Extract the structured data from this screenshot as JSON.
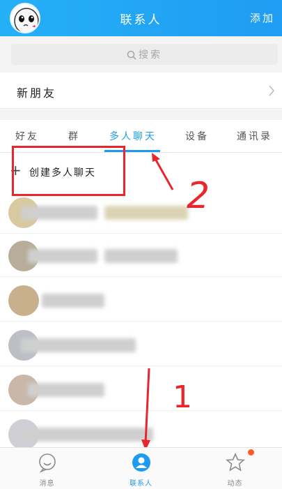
{
  "header": {
    "title": "联系人",
    "add_label": "添加"
  },
  "search": {
    "placeholder": "搜索"
  },
  "new_friends": {
    "label": "新朋友"
  },
  "tabs": [
    {
      "label": "好友"
    },
    {
      "label": "群"
    },
    {
      "label": "多人聊天",
      "active": true
    },
    {
      "label": "设备"
    },
    {
      "label": "通讯录"
    }
  ],
  "create_chat": {
    "label": "创建多人聊天"
  },
  "annotations": {
    "mark_1": "1",
    "mark_2": "2"
  },
  "colors": {
    "accent": "#1d9bf0",
    "annotation": "#e8262c",
    "header": "#25b0f6"
  },
  "bottom_nav": [
    {
      "label": "消息",
      "icon": "chat-bubble-icon"
    },
    {
      "label": "联系人",
      "icon": "person-icon",
      "active": true
    },
    {
      "label": "动态",
      "icon": "star-icon"
    }
  ]
}
